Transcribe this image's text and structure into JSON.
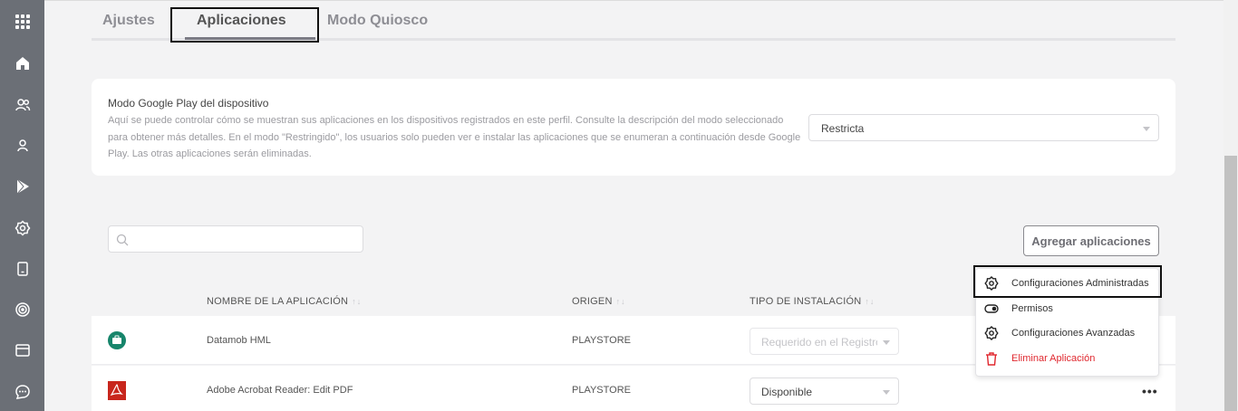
{
  "tabs": [
    {
      "label": "Ajustes"
    },
    {
      "label": "Aplicaciones"
    },
    {
      "label": "Modo Quiosco"
    }
  ],
  "play_mode": {
    "title": "Modo Google Play del dispositivo",
    "description": "Aquí se puede controlar cómo se muestran sus aplicaciones en los dispositivos registrados en este perfil. Consulte la descripción del modo seleccionado para obtener más detalles. En el modo \"Restringido\", los usuarios solo pueden ver e instalar las aplicaciones que se enumeran a continuación desde Google Play. Las otras aplicaciones serán eliminadas.",
    "selected": "Restricta"
  },
  "search": {
    "placeholder": ""
  },
  "add_button": "Agregar aplicaciones",
  "columns": {
    "name": "NOMBRE DE LA APLICACIÓN",
    "origin": "ORIGEN",
    "install_type": "TIPO DE INSTALACIÓN",
    "sort_glyph": "↑↓"
  },
  "rows": [
    {
      "name": "Datamob HML",
      "origin": "PLAYSTORE",
      "install_type": "Requerido en el Registro",
      "icon": "datamob-icon"
    },
    {
      "name": "Adobe Acrobat Reader: Edit PDF",
      "origin": "PLAYSTORE",
      "install_type": "Disponible",
      "icon": "pdf-icon"
    }
  ],
  "menu": {
    "items": [
      {
        "label": "Configuraciones Administradas",
        "icon": "gear-icon"
      },
      {
        "label": "Permisos",
        "icon": "toggle-icon"
      },
      {
        "label": "Configuraciones Avanzadas",
        "icon": "gear-icon"
      },
      {
        "label": "Eliminar Aplicación",
        "icon": "trash-icon",
        "color": "#e0282f"
      }
    ]
  },
  "more_glyph": "•••",
  "sidebar": {
    "icons": [
      "apps-grid-icon",
      "dashboard-icon",
      "users-icon",
      "user-icon",
      "play-store-icon",
      "settings-icon",
      "device-icon",
      "radar-icon",
      "window-icon",
      "chat-icon"
    ]
  },
  "colors": {
    "sidebar": "#6b6f76",
    "danger": "#e0282f",
    "datamob": "#17856b",
    "pdf": "#c8261d"
  }
}
